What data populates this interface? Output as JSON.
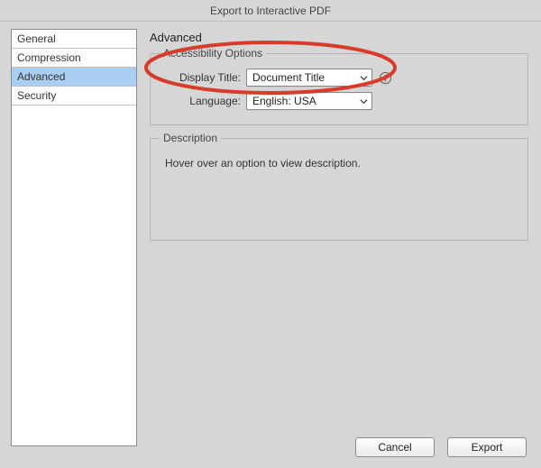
{
  "title": "Export to Interactive PDF",
  "sidebar": {
    "items": [
      {
        "label": "General"
      },
      {
        "label": "Compression"
      },
      {
        "label": "Advanced"
      },
      {
        "label": "Security"
      }
    ],
    "selected_index": 2
  },
  "panel": {
    "title": "Advanced",
    "accessibility": {
      "legend": "Accessibility Options",
      "display_title_label": "Display Title:",
      "display_title_value": "Document Title",
      "language_label": "Language:",
      "language_value": "English: USA"
    },
    "description": {
      "legend": "Description",
      "text": "Hover over an option to view description."
    }
  },
  "buttons": {
    "cancel": "Cancel",
    "export": "Export"
  }
}
